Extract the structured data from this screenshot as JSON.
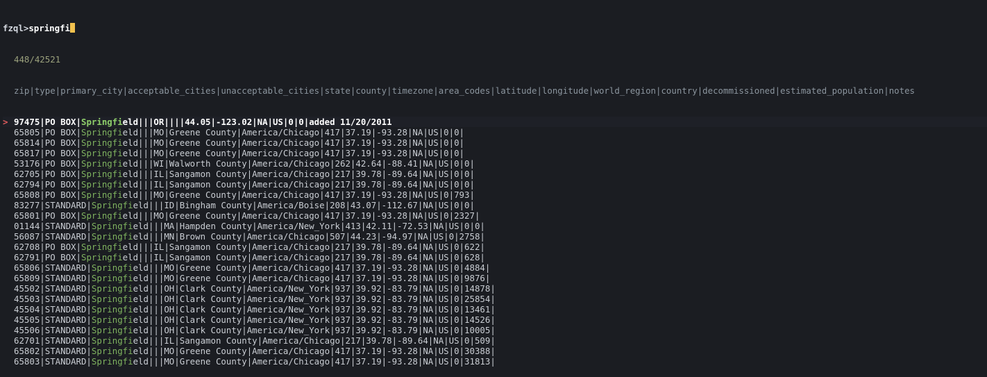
{
  "prompt": {
    "label": "fzql>",
    "query": "springfi"
  },
  "match_count": "448/42521",
  "header": "zip|type|primary_city|acceptable_cities|unacceptable_cities|state|county|timezone|area_codes|latitude|longitude|world_region|country|decommissioned|estimated_population|notes",
  "selected_marker": ">",
  "rows": [
    {
      "pre": "97475|PO BOX|",
      "match": "Springfi",
      "post": "eld|||OR||||44.05|-123.02|NA|US|0|0|added 11/20/2011",
      "selected": true
    },
    {
      "pre": "65805|PO BOX|",
      "match": "Springfi",
      "post": "eld|||MO|Greene County|America/Chicago|417|37.19|-93.28|NA|US|0|0|",
      "selected": false
    },
    {
      "pre": "65814|PO BOX|",
      "match": "Springfi",
      "post": "eld|||MO|Greene County|America/Chicago|417|37.19|-93.28|NA|US|0|0|",
      "selected": false
    },
    {
      "pre": "65817|PO BOX|",
      "match": "Springfi",
      "post": "eld|||MO|Greene County|America/Chicago|417|37.19|-93.28|NA|US|0|0|",
      "selected": false
    },
    {
      "pre": "53176|PO BOX|",
      "match": "Springfi",
      "post": "eld|||WI|Walworth County|America/Chicago|262|42.64|-88.41|NA|US|0|0|",
      "selected": false
    },
    {
      "pre": "62705|PO BOX|",
      "match": "Springfi",
      "post": "eld|||IL|Sangamon County|America/Chicago|217|39.78|-89.64|NA|US|0|0|",
      "selected": false
    },
    {
      "pre": "62794|PO BOX|",
      "match": "Springfi",
      "post": "eld|||IL|Sangamon County|America/Chicago|217|39.78|-89.64|NA|US|0|0|",
      "selected": false
    },
    {
      "pre": "65808|PO BOX|",
      "match": "Springfi",
      "post": "eld|||MO|Greene County|America/Chicago|417|37.19|-93.28|NA|US|0|793|",
      "selected": false
    },
    {
      "pre": "83277|STANDARD|",
      "match": "Springfi",
      "post": "eld|||ID|Bingham County|America/Boise|208|43.07|-112.67|NA|US|0|0|",
      "selected": false
    },
    {
      "pre": "65801|PO BOX|",
      "match": "Springfi",
      "post": "eld|||MO|Greene County|America/Chicago|417|37.19|-93.28|NA|US|0|2327|",
      "selected": false
    },
    {
      "pre": "01144|STANDARD|",
      "match": "Springfi",
      "post": "eld|||MA|Hampden County|America/New_York|413|42.11|-72.53|NA|US|0|0|",
      "selected": false
    },
    {
      "pre": "56087|STANDARD|",
      "match": "Springfi",
      "post": "eld|||MN|Brown County|America/Chicago|507|44.23|-94.97|NA|US|0|2758|",
      "selected": false
    },
    {
      "pre": "62708|PO BOX|",
      "match": "Springfi",
      "post": "eld|||IL|Sangamon County|America/Chicago|217|39.78|-89.64|NA|US|0|622|",
      "selected": false
    },
    {
      "pre": "62791|PO BOX|",
      "match": "Springfi",
      "post": "eld|||IL|Sangamon County|America/Chicago|217|39.78|-89.64|NA|US|0|628|",
      "selected": false
    },
    {
      "pre": "65806|STANDARD|",
      "match": "Springfi",
      "post": "eld|||MO|Greene County|America/Chicago|417|37.19|-93.28|NA|US|0|4884|",
      "selected": false
    },
    {
      "pre": "65809|STANDARD|",
      "match": "Springfi",
      "post": "eld|||MO|Greene County|America/Chicago|417|37.19|-93.28|NA|US|0|9876|",
      "selected": false
    },
    {
      "pre": "45502|STANDARD|",
      "match": "Springfi",
      "post": "eld|||OH|Clark County|America/New_York|937|39.92|-83.79|NA|US|0|14878|",
      "selected": false
    },
    {
      "pre": "45503|STANDARD|",
      "match": "Springfi",
      "post": "eld|||OH|Clark County|America/New_York|937|39.92|-83.79|NA|US|0|25854|",
      "selected": false
    },
    {
      "pre": "45504|STANDARD|",
      "match": "Springfi",
      "post": "eld|||OH|Clark County|America/New_York|937|39.92|-83.79|NA|US|0|13461|",
      "selected": false
    },
    {
      "pre": "45505|STANDARD|",
      "match": "Springfi",
      "post": "eld|||OH|Clark County|America/New_York|937|39.92|-83.79|NA|US|0|14526|",
      "selected": false
    },
    {
      "pre": "45506|STANDARD|",
      "match": "Springfi",
      "post": "eld|||OH|Clark County|America/New_York|937|39.92|-83.79|NA|US|0|10005|",
      "selected": false
    },
    {
      "pre": "62701|STANDARD|",
      "match": "Springfi",
      "post": "eld|||IL|Sangamon County|America/Chicago|217|39.78|-89.64|NA|US|0|509|",
      "selected": false
    },
    {
      "pre": "65802|STANDARD|",
      "match": "Springfi",
      "post": "eld|||MO|Greene County|America/Chicago|417|37.19|-93.28|NA|US|0|30388|",
      "selected": false
    },
    {
      "pre": "65803|STANDARD|",
      "match": "Springfi",
      "post": "eld|||MO|Greene County|America/Chicago|417|37.19|-93.28|NA|US|0|31813|",
      "selected": false
    }
  ],
  "colors": {
    "background": "#1b1d22",
    "match_highlight": "#7fb35f",
    "selected_marker": "#e25b5b",
    "cursor": "#f2c14e"
  }
}
